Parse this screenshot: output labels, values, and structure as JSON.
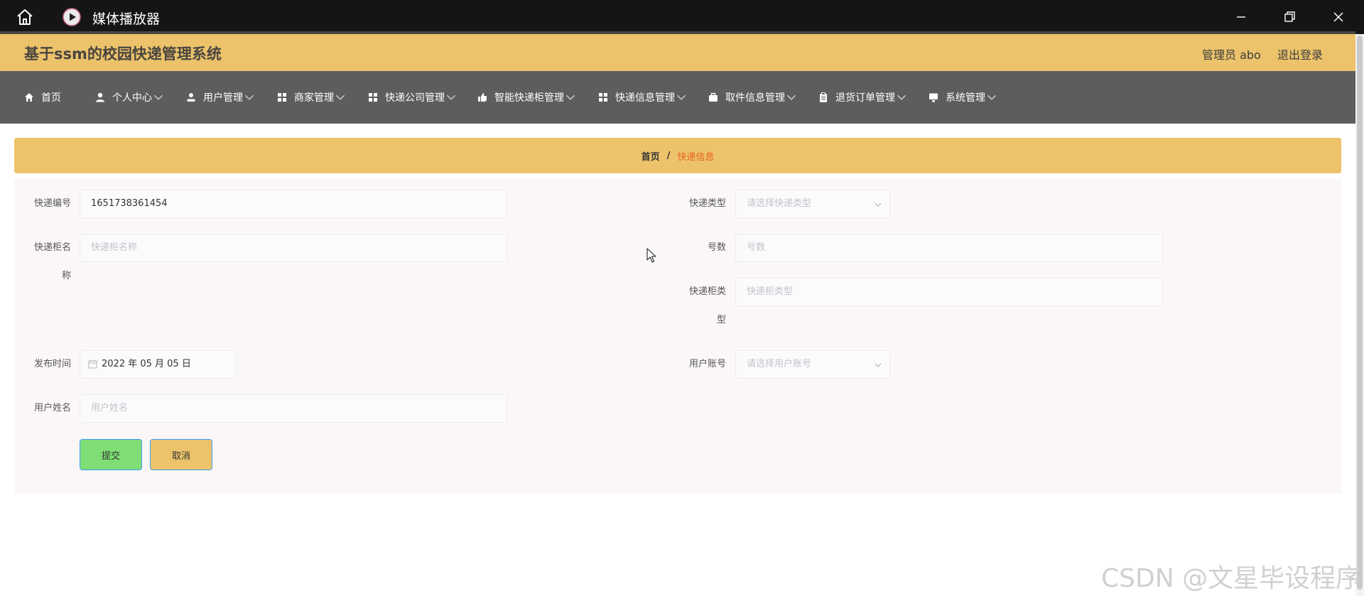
{
  "titlebar": {
    "title": "媒体播放器"
  },
  "header": {
    "app_title": "基于ssm的校园快递管理系统",
    "user_label": "管理员 abo",
    "logout_label": "退出登录"
  },
  "nav": {
    "items": [
      {
        "label": "首页",
        "icon": "home-icon"
      },
      {
        "label": "个人中心",
        "icon": "person-icon"
      },
      {
        "label": "用户管理",
        "icon": "user-icon"
      },
      {
        "label": "商家管理",
        "icon": "grid-icon"
      },
      {
        "label": "快递公司管理",
        "icon": "grid-icon"
      },
      {
        "label": "智能快递柜管理",
        "icon": "thumb-icon"
      },
      {
        "label": "快递信息管理",
        "icon": "grid-icon"
      },
      {
        "label": "取件信息管理",
        "icon": "briefcase-icon"
      },
      {
        "label": "退货订单管理",
        "icon": "clipboard-icon"
      },
      {
        "label": "系统管理",
        "icon": "monitor-icon"
      }
    ]
  },
  "breadcrumb": {
    "home": "首页",
    "separator": "/",
    "current": "快递信息"
  },
  "form": {
    "express_no": {
      "label": "快递编号",
      "value": "1651738361454"
    },
    "express_type": {
      "label": "快递类型",
      "placeholder": "请选择快递类型"
    },
    "cabinet_name": {
      "label": "快递柜名称",
      "placeholder": "快递柜名称"
    },
    "number": {
      "label": "号数",
      "placeholder": "号数"
    },
    "cabinet_type": {
      "label": "快递柜类型",
      "placeholder": "快递柜类型"
    },
    "publish_time": {
      "label": "发布时间",
      "value": "2022 年 05 月 05 日"
    },
    "user_account": {
      "label": "用户账号",
      "placeholder": "请选择用户账号"
    },
    "user_name": {
      "label": "用户姓名",
      "placeholder": "用户姓名"
    }
  },
  "buttons": {
    "submit": "提交",
    "cancel": "取消"
  },
  "watermark": "CSDN @文星毕设程序",
  "colors": {
    "header_bg": "#ecc36a",
    "nav_bg": "#5f5c5c",
    "breadcrumb_current": "#e7621c",
    "submit_bg": "#7fde75",
    "cancel_bg": "#ecc36a"
  }
}
